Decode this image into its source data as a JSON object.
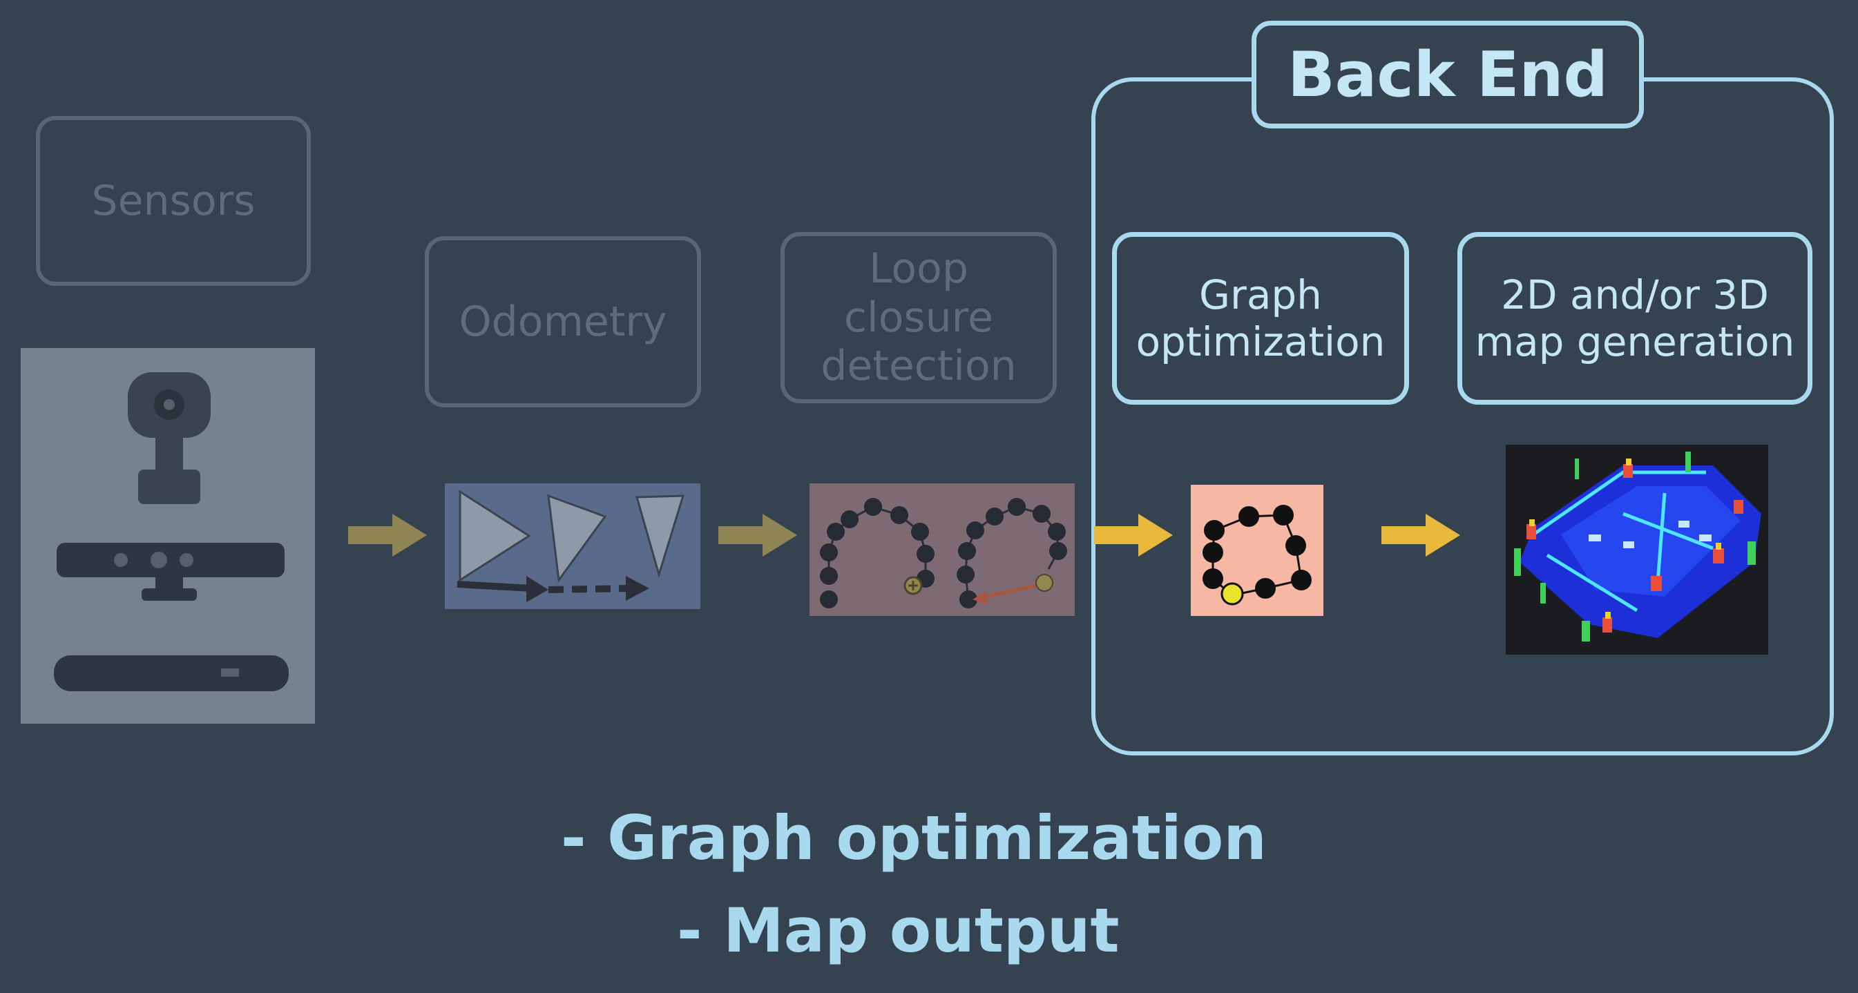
{
  "diagram": {
    "sensors_label": "Sensors",
    "odometry_label": "Odometry",
    "loop_closure_label": "Loop\nclosure\ndetection",
    "back_end_title": "Back End",
    "graph_optimization_label": "Graph\noptimization",
    "map_generation_label": "2D and/or 3D\nmap generation"
  },
  "bullets": [
    "- Graph optimization",
    "- Map output"
  ],
  "colors": {
    "background": "#35424f",
    "highlight": "#a9d9ef",
    "dimmed_border": "#586675",
    "arrow": "#e8b93a"
  }
}
